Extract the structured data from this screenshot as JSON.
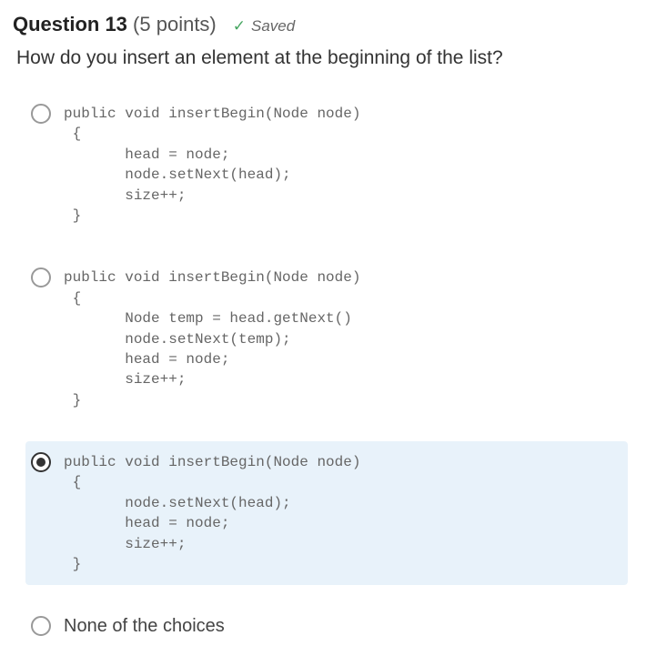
{
  "header": {
    "question_label": "Question 13",
    "points_label": "(5 points)",
    "saved_label": "Saved"
  },
  "body": {
    "prompt": "How do you insert an element at the beginning of the list?"
  },
  "options": [
    {
      "selected": false,
      "type": "code",
      "code": "public void insertBegin(Node node)\n {\n       head = node;\n       node.setNext(head);\n       size++;\n }"
    },
    {
      "selected": false,
      "type": "code",
      "code": "public void insertBegin(Node node)\n {\n       Node temp = head.getNext()\n       node.setNext(temp);\n       head = node;\n       size++;\n }"
    },
    {
      "selected": true,
      "type": "code",
      "code": "public void insertBegin(Node node)\n {\n       node.setNext(head);\n       head = node;\n       size++;\n }"
    },
    {
      "selected": false,
      "type": "text",
      "text": "None of the choices"
    }
  ]
}
